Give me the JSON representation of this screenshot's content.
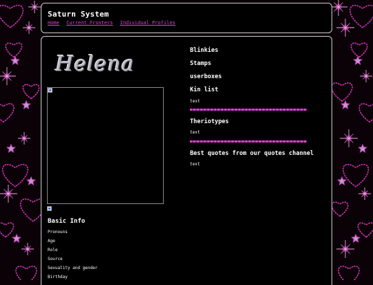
{
  "header": {
    "title": "Saturn System",
    "nav": [
      "Home",
      "Current Fronters",
      "Individual Profiles"
    ]
  },
  "profile": {
    "name": "Helena",
    "basic_info_heading": "Basic Info",
    "fields": [
      "Pronouns",
      "Age",
      "Role",
      "Source",
      "Sexuality and gender",
      "Birthday"
    ]
  },
  "right": {
    "blinkies": "Blinkies",
    "stamps": "Stamps",
    "userboxes": "userboxes",
    "kin_list": "Kin list",
    "kin_text": "text",
    "theriotypes": "Theriotypes",
    "therio_text": "text",
    "quotes": "Best quotes from our quotes channel",
    "quotes_text": "text"
  },
  "colors": {
    "accent": "#e040d8",
    "background": "#000000",
    "border": "#cfcfcf"
  }
}
